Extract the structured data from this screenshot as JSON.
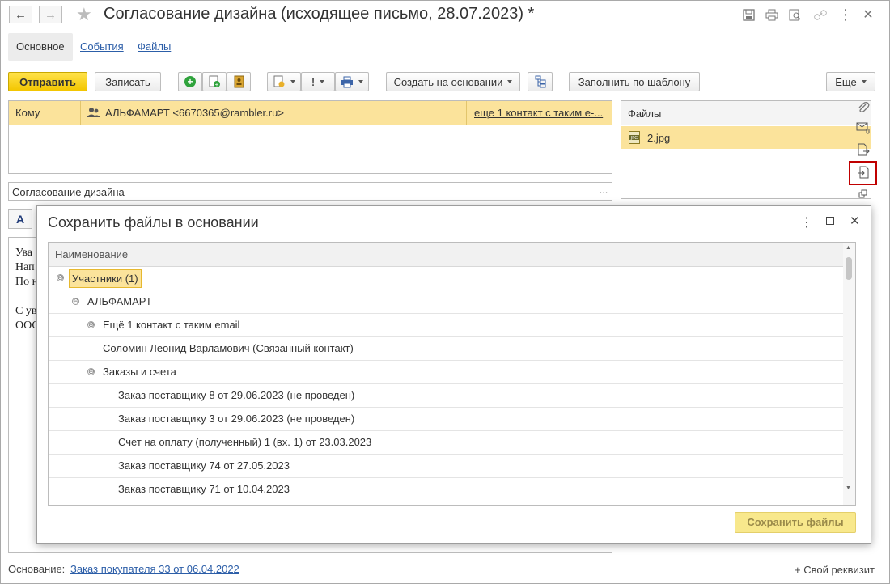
{
  "window": {
    "title": "Согласование дизайна (исходящее письмо, 28.07.2023) *"
  },
  "tabs": [
    {
      "label": "Основное"
    },
    {
      "label": "События"
    },
    {
      "label": "Файлы"
    }
  ],
  "toolbar": {
    "send_label": "Отправить",
    "save_label": "Записать",
    "create_based_label": "Создать на основании",
    "fill_template_label": "Заполнить по шаблону",
    "more_label": "Еще"
  },
  "recipients": {
    "to_label": "Кому",
    "to_value": "АЛЬФАМАРТ <6670365@rambler.ru>",
    "more_contact_link": "еще 1 контакт с таким е-..."
  },
  "files_panel": {
    "header": "Файлы",
    "items": [
      {
        "name": "2.jpg"
      }
    ]
  },
  "subject": {
    "value": "Согласование дизайна",
    "select_label": "..."
  },
  "format": {
    "text_icon_label": "A"
  },
  "body_visible_text": [
    "Ува",
    "Нап",
    "По н",
    "С ув",
    "ООС"
  ],
  "dialog": {
    "title": "Сохранить файлы в основании",
    "column_header": "Наименование",
    "rows": [
      {
        "label": "Участники (1)",
        "toggle": "⊖"
      },
      {
        "label": "АЛЬФАМАРТ",
        "toggle": "⊖"
      },
      {
        "label": "Ещё 1 контакт с таким email",
        "toggle": "⊕"
      },
      {
        "label": "Соломин Леонид Варламович (Связанный контакт)",
        "toggle": ""
      },
      {
        "label": "Заказы и счета",
        "toggle": "⊖"
      },
      {
        "label": "Заказ поставщику 8 от 29.06.2023 (не проведен)",
        "toggle": ""
      },
      {
        "label": "Заказ поставщику 3 от 29.06.2023 (не проведен)",
        "toggle": ""
      },
      {
        "label": "Счет на оплату (полученный) 1 (вх. 1) от 23.03.2023",
        "toggle": ""
      },
      {
        "label": "Заказ поставщику 74 от 27.05.2023",
        "toggle": ""
      },
      {
        "label": "Заказ поставщику 71 от 10.04.2023",
        "toggle": ""
      }
    ],
    "save_button_label": "Сохранить файлы"
  },
  "footer": {
    "basis_label": "Основание:",
    "basis_link": "Заказ покупателя 33 от 06.04.2022",
    "custom_attr_label": "+ Свой реквизит"
  },
  "colors": {
    "accent_yellow": "#f5c900",
    "selection_yellow": "#fbe39b",
    "link_blue": "#2c5ea8",
    "highlight_red": "#c00000"
  }
}
